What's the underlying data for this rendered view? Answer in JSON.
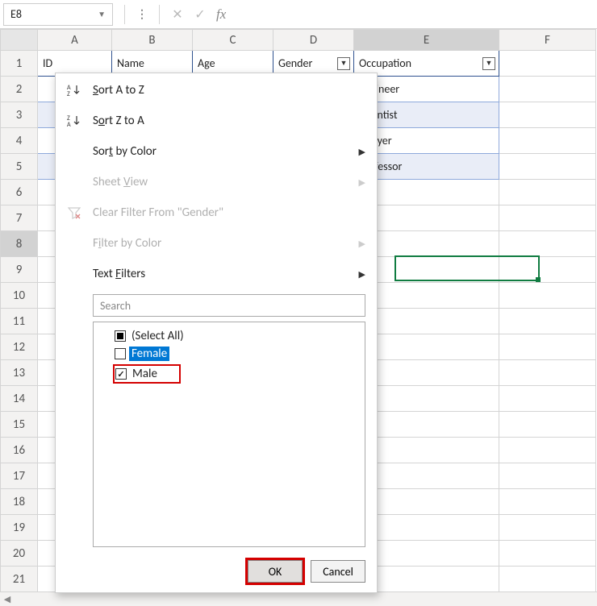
{
  "formula_bar": {
    "name_box": "E8",
    "cancel_tip": "✕",
    "enter_tip": "✓",
    "fx_label": "fx"
  },
  "columns": [
    "A",
    "B",
    "C",
    "D",
    "E",
    "F"
  ],
  "rows": [
    "1",
    "2",
    "3",
    "4",
    "5",
    "6",
    "7",
    "8",
    "9",
    "10",
    "11",
    "12",
    "13",
    "14",
    "15",
    "16",
    "17",
    "18",
    "19",
    "20",
    "21"
  ],
  "table": {
    "headers": {
      "A": "ID",
      "B": "Name",
      "C": "Age",
      "D": "Gender",
      "E": "Occupation"
    },
    "rows": [
      {
        "E": "Engineer"
      },
      {
        "E": "Scientist"
      },
      {
        "E": "Lawyer"
      },
      {
        "E": "Professor"
      }
    ]
  },
  "filter_menu": {
    "sort_az": "Sort A to Z",
    "sort_za": "Sort Z to A",
    "sort_color": "Sort by Color",
    "sheet_view": "Sheet View",
    "clear_filter": "Clear Filter From \"Gender\"",
    "filter_color": "Filter by Color",
    "text_filters": "Text Filters",
    "search_placeholder": "Search",
    "items": {
      "select_all": "(Select All)",
      "female": "Female",
      "male": "Male"
    },
    "ok": "OK",
    "cancel": "Cancel"
  }
}
